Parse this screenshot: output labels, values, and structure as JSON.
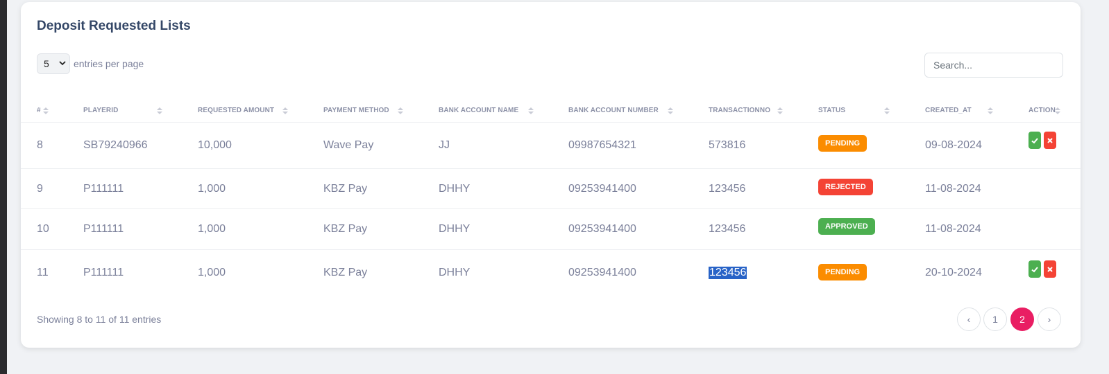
{
  "title": "Deposit Requested Lists",
  "per_page": {
    "value": "5",
    "label": "entries per page"
  },
  "search": {
    "placeholder": "Search..."
  },
  "columns": [
    "#",
    "PLAYERID",
    "REQUESTED AMOUNT",
    "PAYMENT METHOD",
    "BANK ACCOUNT NAME",
    "BANK ACCOUNT NUMBER",
    "TRANSACTIONNO",
    "STATUS",
    "CREATED_AT",
    "ACTION"
  ],
  "rows": [
    {
      "id": "8",
      "player_id": "SB79240966",
      "amount": "10,000",
      "payment_method": "Wave Pay",
      "account_name": "JJ",
      "account_number": "09987654321",
      "transaction_no": "573816",
      "status": "PENDING",
      "created_at": "09-08-2024"
    },
    {
      "id": "9",
      "player_id": "P111111",
      "amount": "1,000",
      "payment_method": "KBZ Pay",
      "account_name": "DHHY",
      "account_number": "09253941400",
      "transaction_no": "123456",
      "status": "REJECTED",
      "created_at": "11-08-2024"
    },
    {
      "id": "10",
      "player_id": "P111111",
      "amount": "1,000",
      "payment_method": "KBZ Pay",
      "account_name": "DHHY",
      "account_number": "09253941400",
      "transaction_no": "123456",
      "status": "APPROVED",
      "created_at": "11-08-2024"
    },
    {
      "id": "11",
      "player_id": "P111111",
      "amount": "1,000",
      "payment_method": "KBZ Pay",
      "account_name": "DHHY",
      "account_number": "09253941400",
      "transaction_no": "123456",
      "status": "PENDING",
      "created_at": "20-10-2024"
    }
  ],
  "footer": {
    "showing": "Showing 8 to 11 of 11 entries"
  },
  "pagination": {
    "prev": "‹",
    "pages": [
      "1",
      "2"
    ],
    "active": "2",
    "next": "›"
  },
  "colors": {
    "pending": "#fb8c00",
    "rejected": "#f44335",
    "approved": "#4caf50",
    "active_page": "#e91e63",
    "title": "#344767"
  },
  "icons": {
    "approve": "check-icon",
    "reject": "close-icon"
  }
}
